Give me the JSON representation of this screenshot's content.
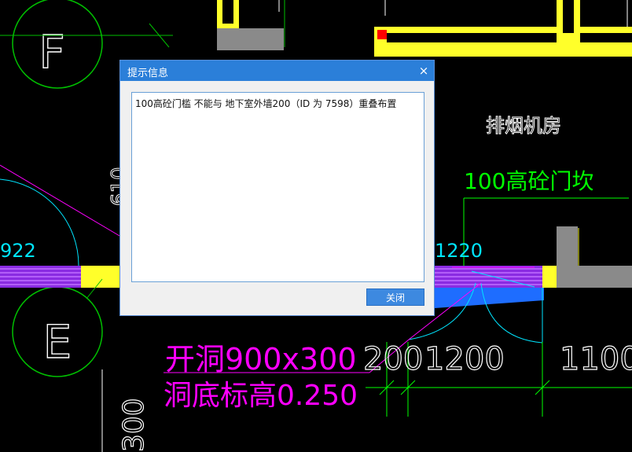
{
  "dialog": {
    "title": "提示信息",
    "close_icon": "×",
    "message": "100高砼门槛 不能与 地下室外墙200（ID 为 7598）重叠布置",
    "ok_label": "关闭"
  },
  "drawing": {
    "axis_label_top": "F",
    "axis_label_bottom": "E",
    "room_name": "排烟机房",
    "door_sill_label": "100高砼门坎",
    "opening_label": "开洞900x300",
    "opening_elev_label": "洞底标高0.250",
    "dim_left": "922",
    "dim_top_right": "1220",
    "dim_200": "200",
    "dim_1200": "1200",
    "dim_1100": "1100",
    "dim_vertical_bottom": "300",
    "dim_vertical_mid": "610",
    "colors": {
      "background": "#000000",
      "wall": "#ffff2a",
      "column": "#808080",
      "axis": "#00c000",
      "dimension": "#00ff00",
      "annotation_magenta": "#ff00ff",
      "arc_cyan": "#00e5ff",
      "text_white": "#ffffff",
      "hatch_purple": "#9b30ff",
      "selection_blue": "#1e6dff"
    }
  }
}
